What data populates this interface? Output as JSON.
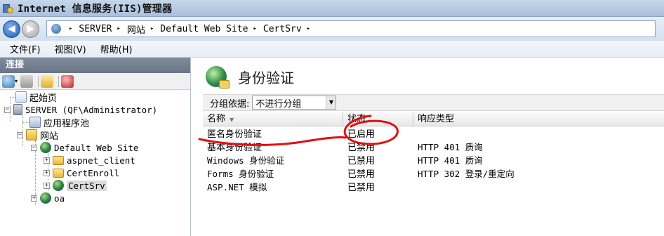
{
  "window": {
    "title": "Internet 信息服务(IIS)管理器"
  },
  "address": {
    "segments": [
      "SERVER",
      "网站",
      "Default Web Site",
      "CertSrv"
    ],
    "separator": "▸"
  },
  "menu": {
    "items": [
      "文件(F)",
      "视图(V)",
      "帮助(H)"
    ]
  },
  "connections": {
    "header": "连接",
    "tree": [
      {
        "label": "起始页"
      },
      {
        "label": "SERVER (QF\\Administrator)"
      },
      {
        "label": "应用程序池"
      },
      {
        "label": "网站"
      },
      {
        "label": "Default Web Site"
      },
      {
        "label": "aspnet_client"
      },
      {
        "label": "CertEnroll"
      },
      {
        "label": "CertSrv"
      },
      {
        "label": "oa"
      }
    ]
  },
  "main": {
    "title": "身份验证",
    "group_by_label": "分组依据:",
    "group_by_value": "不进行分组",
    "columns": [
      "名称",
      "状态",
      "响应类型"
    ],
    "rows": [
      {
        "name": "匿名身份验证",
        "status": "已启用",
        "response": ""
      },
      {
        "name": "基本身份验证",
        "status": "已禁用",
        "response": "HTTP 401 质询"
      },
      {
        "name": "Windows 身份验证",
        "status": "已禁用",
        "response": "HTTP 401 质询"
      },
      {
        "name": "Forms 身份验证",
        "status": "已禁用",
        "response": "HTTP 302 登录/重定向"
      },
      {
        "name": "ASP.NET 模拟",
        "status": "已禁用",
        "response": ""
      }
    ]
  },
  "colors": {
    "annotation": "#e01010",
    "title_gradient": "#a9c0dc"
  }
}
